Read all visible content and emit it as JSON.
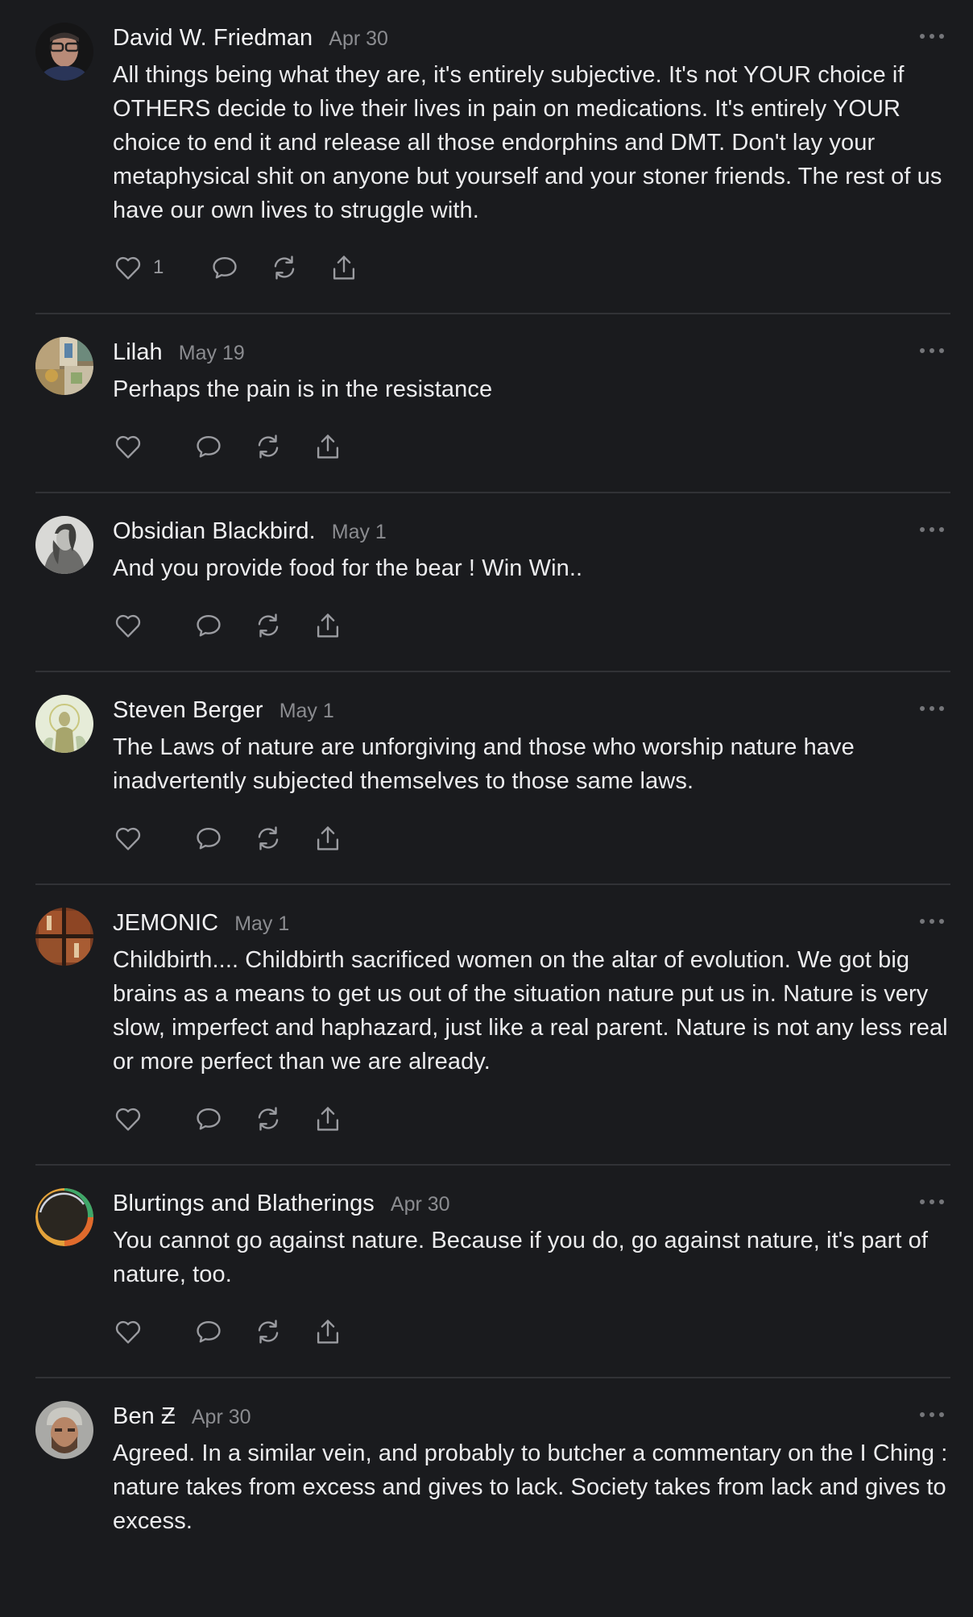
{
  "comments": [
    {
      "author": "David W. Friedman",
      "date": "Apr 30",
      "text": "All things being what they are, it's entirely subjective. It's not YOUR choice if OTHERS decide to live their lives in pain on medications. It's entirely YOUR choice to end it and release all those endorphins and DMT. Don't lay your metaphysical shit on anyone but yourself and your stoner friends. The rest of us have our own lives to struggle with.",
      "likes": "1"
    },
    {
      "author": "Lilah",
      "date": "May 19",
      "text": "Perhaps the pain is in the resistance",
      "likes": ""
    },
    {
      "author": "Obsidian Blackbird.",
      "date": "May 1",
      "text": "And you provide food for the bear ! Win Win..",
      "likes": ""
    },
    {
      "author": "Steven Berger",
      "date": "May 1",
      "text": "The Laws of nature are unforgiving and those who worship nature have inadvertently subjected themselves to those same laws.",
      "likes": ""
    },
    {
      "author": "JEMONIC",
      "date": "May 1",
      "text": "Childbirth.... Childbirth sacrificed women on the altar of evolution. We got big brains as a means to get us out of the situation nature put us in. Nature is very slow, imperfect and haphazard, just like a real parent. Nature is not any less real or more perfect than we are already.",
      "likes": ""
    },
    {
      "author": "Blurtings and Blatherings",
      "date": "Apr 30",
      "text": "You cannot go against nature. Because if you do, go against nature, it's part of nature, too.",
      "likes": ""
    },
    {
      "author": "Ben Ƶ",
      "date": "Apr 30",
      "text": "Agreed. In a similar vein, and probably to butcher a commentary on the I Ching : nature takes from excess and gives to lack. Society takes from lack and gives to excess.",
      "likes": ""
    }
  ],
  "icons": {
    "like": "heart-icon",
    "reply": "speech-bubble-icon",
    "restack": "refresh-arrows-icon",
    "share": "share-upload-icon",
    "more": "ellipsis-icon"
  },
  "colors": {
    "background": "#1a1b1e",
    "text": "#ececee",
    "muted": "#8b8c90",
    "divider": "#313236"
  }
}
